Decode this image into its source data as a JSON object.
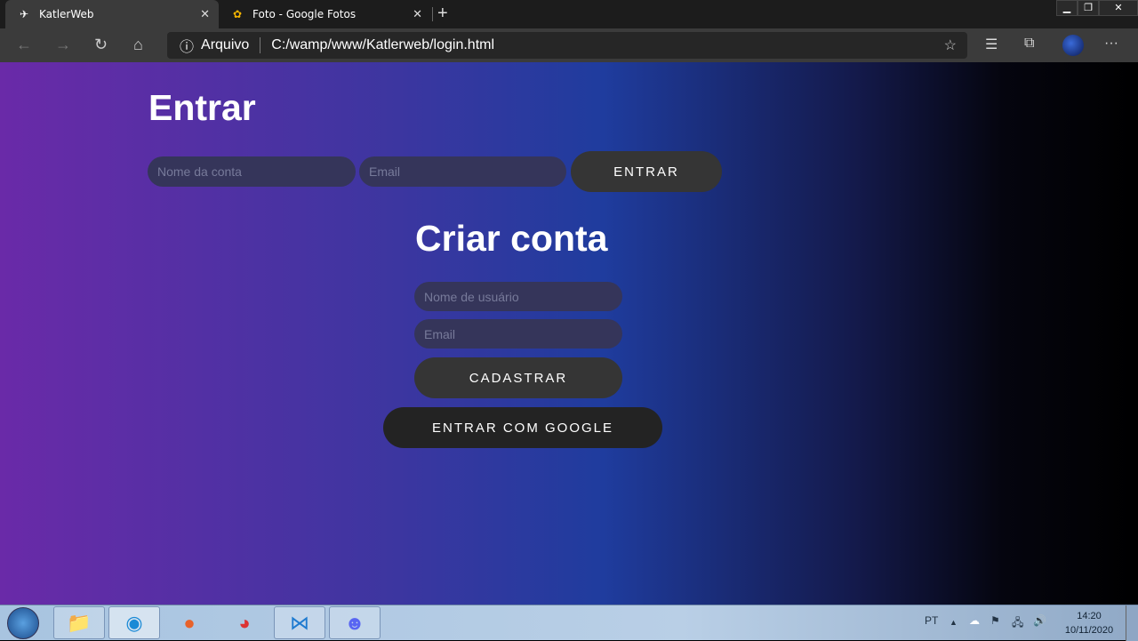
{
  "browser": {
    "tabs": [
      {
        "title": "KatlerWeb",
        "icon": "paper-plane-icon"
      },
      {
        "title": "Foto - Google Fotos",
        "icon": "google-photos-icon"
      }
    ],
    "address": {
      "security_label": "Arquivo",
      "url": "C:/wamp/www/Katlerweb/login.html"
    }
  },
  "login": {
    "title": "Entrar",
    "account_placeholder": "Nome da conta",
    "email_placeholder": "Email",
    "submit": "ENTRAR"
  },
  "signup": {
    "title": "Criar conta",
    "username_placeholder": "Nome de usuário",
    "email_placeholder": "Email",
    "submit": "CADASTRAR",
    "google": "ENTRAR COM GOOGLE"
  },
  "taskbar": {
    "language": "PT",
    "time": "14:20",
    "date": "10/11/2020"
  },
  "colors": {
    "gradient_start": "#6a2aa8",
    "gradient_mid": "#1f3c9e",
    "gradient_end": "#000000",
    "button": "#353535"
  }
}
